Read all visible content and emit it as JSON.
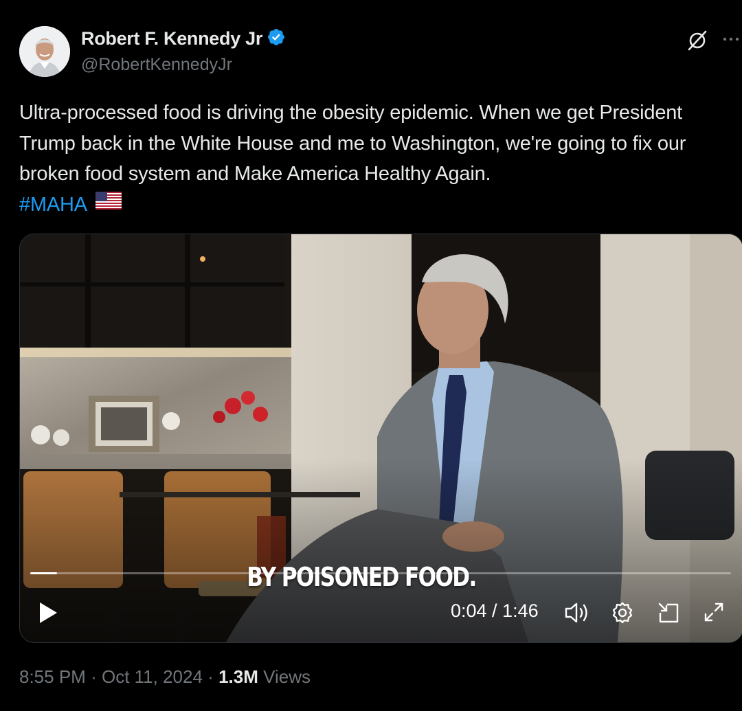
{
  "author": {
    "name": "Robert F. Kennedy Jr",
    "handle": "@RobertKennedyJr",
    "verified": true,
    "verified_color": "#1d9bf0"
  },
  "header_icons": [
    "grok-icon",
    "more-icon"
  ],
  "tweet": {
    "text": "Ultra-processed food is driving the obesity epidemic. When we get President Trump back in the White House and me to Washington, we're going to fix our broken food system and Make America Healthy Again.",
    "hashtag": "#MAHA",
    "emoji": "us-flag"
  },
  "video": {
    "caption": "BY POISONED FOOD.",
    "current_time": "0:04",
    "duration": "1:46",
    "time_display": "0:04 / 1:46",
    "progress_fraction": 0.038,
    "controls": [
      "play-icon",
      "volume-icon",
      "settings-icon",
      "picture-in-picture-icon",
      "fullscreen-icon"
    ]
  },
  "meta": {
    "time": "8:55 PM",
    "date": "Oct 11, 2024",
    "separator": "·",
    "views_count": "1.3M",
    "views_label": "Views"
  },
  "colors": {
    "background": "#000000",
    "text": "#e7e9ea",
    "secondary": "#71767b",
    "link": "#1d9bf0"
  }
}
